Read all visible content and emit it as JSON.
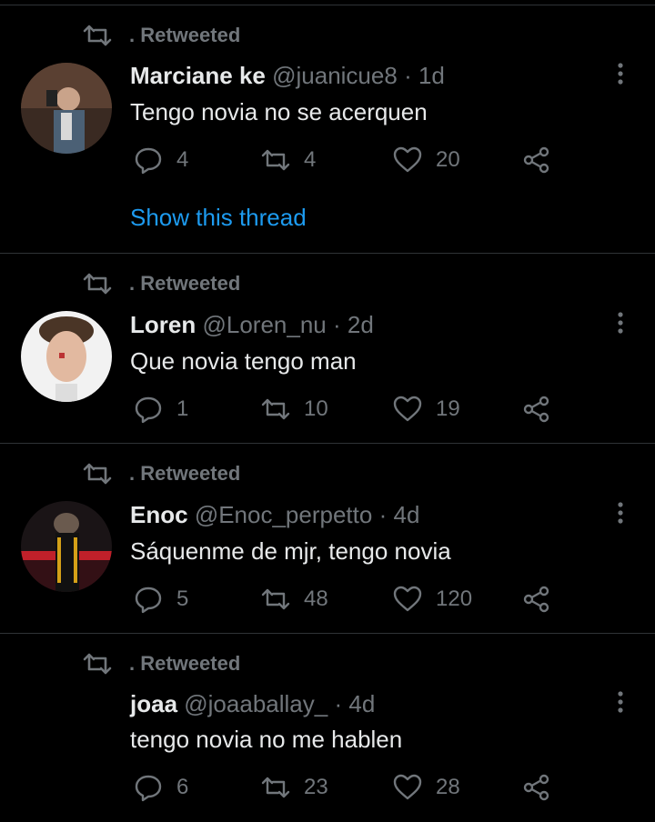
{
  "retweet_label": ". Retweeted",
  "thread_link": "Show this thread",
  "tweets": [
    {
      "name": "Marciane ke",
      "handle": "@juanicue8",
      "dot": "·",
      "time": "1d",
      "text": "Tengo novia no se acerquen",
      "replies": "4",
      "retweets": "4",
      "likes": "20"
    },
    {
      "name": "Loren",
      "handle": "@Loren_nu",
      "dot": "·",
      "time": "2d",
      "text": "Que novia tengo man",
      "replies": "1",
      "retweets": "10",
      "likes": "19"
    },
    {
      "name": "Enoc",
      "handle": "@Enoc_perpetto",
      "dot": "·",
      "time": "4d",
      "text": "Sáquenme de mjr, tengo novia",
      "replies": "5",
      "retweets": "48",
      "likes": "120"
    },
    {
      "name": "joaa",
      "handle": "@joaaballay_",
      "dot": "·",
      "time": "4d",
      "text": "tengo novia no me hablen",
      "replies": "6",
      "retweets": "23",
      "likes": "28"
    }
  ],
  "colors": {
    "background": "#000000",
    "text": "#e7e9ea",
    "muted": "#71767b",
    "link": "#1d9bf0",
    "divider": "#2f3336"
  }
}
